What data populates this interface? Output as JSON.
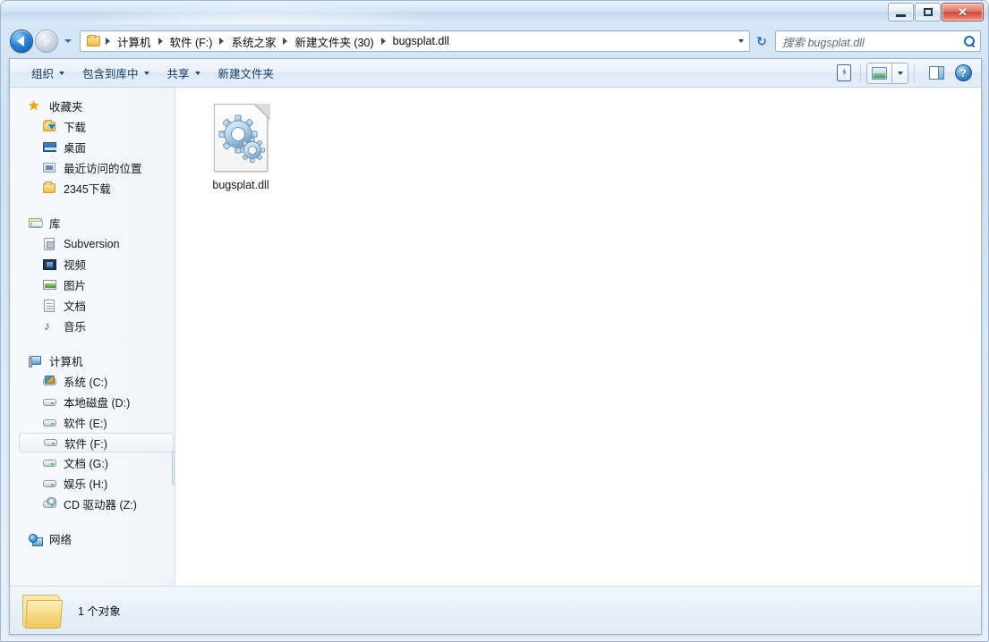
{
  "window": {
    "controls": {
      "minimize": "minimize-button",
      "maximize": "restore-button",
      "close_glyph": "✕"
    }
  },
  "navigation": {
    "back_tooltip": "后退",
    "forward_tooltip": "前进",
    "history_tooltip": "最近浏览的页面",
    "refresh_glyph": "↻",
    "breadcrumb": [
      "计算机",
      "软件 (F:)",
      "系统之家",
      "新建文件夹 (30)",
      "bugsplat.dll"
    ]
  },
  "search": {
    "placeholder": "搜索 bugsplat.dll",
    "value": ""
  },
  "toolbar": {
    "items": [
      {
        "label": "组织",
        "has_caret": true
      },
      {
        "label": "包含到库中",
        "has_caret": true
      },
      {
        "label": "共享",
        "has_caret": true
      },
      {
        "label": "新建文件夹",
        "has_caret": false
      }
    ],
    "right_icons": [
      "media-preview-icon",
      "view-mode-icon",
      "view-mode-dropdown-icon",
      "preview-pane-icon",
      "help-icon"
    ],
    "help_glyph": "?"
  },
  "sidebar": {
    "groups": [
      {
        "name": "favorites",
        "header": {
          "label": "收藏夹",
          "icon": "star-icon"
        },
        "items": [
          {
            "label": "下载",
            "icon": "folder-download-icon"
          },
          {
            "label": "桌面",
            "icon": "desktop-icon"
          },
          {
            "label": "最近访问的位置",
            "icon": "recent-places-icon"
          },
          {
            "label": "2345下载",
            "icon": "folder-icon"
          }
        ]
      },
      {
        "name": "libraries",
        "header": {
          "label": "库",
          "icon": "library-icon"
        },
        "items": [
          {
            "label": "Subversion",
            "icon": "subversion-icon"
          },
          {
            "label": "视频",
            "icon": "video-icon"
          },
          {
            "label": "图片",
            "icon": "pictures-icon"
          },
          {
            "label": "文档",
            "icon": "documents-icon"
          },
          {
            "label": "音乐",
            "icon": "music-icon"
          }
        ]
      },
      {
        "name": "computer",
        "header": {
          "label": "计算机",
          "icon": "computer-icon"
        },
        "items": [
          {
            "label": "系统 (C:)",
            "icon": "system-drive-icon",
            "selected": false
          },
          {
            "label": "本地磁盘 (D:)",
            "icon": "drive-icon",
            "selected": false
          },
          {
            "label": "软件 (E:)",
            "icon": "drive-icon",
            "selected": false
          },
          {
            "label": "软件 (F:)",
            "icon": "drive-icon",
            "selected": true
          },
          {
            "label": "文档 (G:)",
            "icon": "drive-icon",
            "selected": false
          },
          {
            "label": "娱乐 (H:)",
            "icon": "drive-icon",
            "selected": false
          },
          {
            "label": "CD 驱动器 (Z:)",
            "icon": "cd-drive-icon",
            "selected": false
          }
        ]
      },
      {
        "name": "network",
        "header": {
          "label": "网络",
          "icon": "network-icon"
        },
        "items": []
      }
    ]
  },
  "files": [
    {
      "name": "bugsplat.dll",
      "icon": "dll-gears-icon"
    }
  ],
  "status": {
    "text": "1 个对象",
    "icon": "folder-large-icon"
  },
  "colors": {
    "accent": "#2a6fb5",
    "close_button": "#c94635",
    "frame": "#cfe0f2",
    "selection_border": "#d3ddea"
  }
}
